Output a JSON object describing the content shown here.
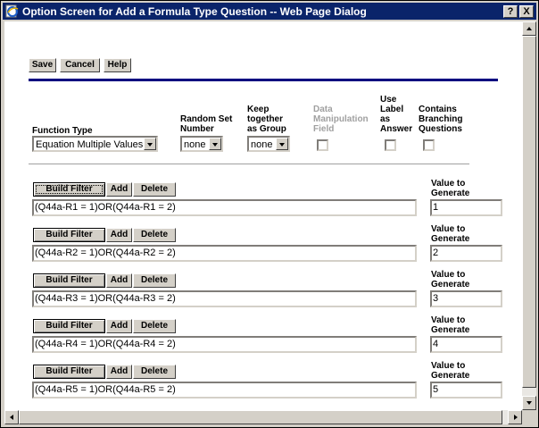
{
  "window": {
    "title": "Option Screen for Add a Formula Type Question -- Web Page Dialog",
    "help_btn": "?",
    "close_btn": "X"
  },
  "toolbar": {
    "save": "Save",
    "cancel": "Cancel",
    "help": "Help"
  },
  "options": {
    "function_type": {
      "label": "Function Type",
      "value": "Equation Multiple Values"
    },
    "random_set": {
      "label_l1": "Random Set",
      "label_l2": "Number",
      "value": "none"
    },
    "keep_together": {
      "label_l1": "Keep",
      "label_l2": "together",
      "label_l3": "as Group",
      "value": "none"
    },
    "data_manip": {
      "label_l1": "Data",
      "label_l2": "Manipulation",
      "label_l3": "Field",
      "checked": false
    },
    "use_label": {
      "label_l1": "Use",
      "label_l2": "Label",
      "label_l3": "as",
      "label_l4": "Answer",
      "checked": false
    },
    "branching": {
      "label_l1": "Contains",
      "label_l2": "Branching",
      "label_l3": "Questions",
      "checked": false
    }
  },
  "filter_buttons": {
    "build": "Build Filter",
    "add": "Add",
    "delete": "Delete"
  },
  "value_label": {
    "l1": "Value to",
    "l2": "Generate"
  },
  "rows": [
    {
      "filter": "(Q44a-R1 = 1)OR(Q44a-R1 = 2)",
      "value": "1"
    },
    {
      "filter": "(Q44a-R2 = 1)OR(Q44a-R2 = 2)",
      "value": "2"
    },
    {
      "filter": "(Q44a-R3 = 1)OR(Q44a-R3 = 2)",
      "value": "3"
    },
    {
      "filter": "(Q44a-R4 = 1)OR(Q44a-R4 = 2)",
      "value": "4"
    },
    {
      "filter": "(Q44a-R5 = 1)OR(Q44a-R5 = 2)",
      "value": "5"
    }
  ]
}
